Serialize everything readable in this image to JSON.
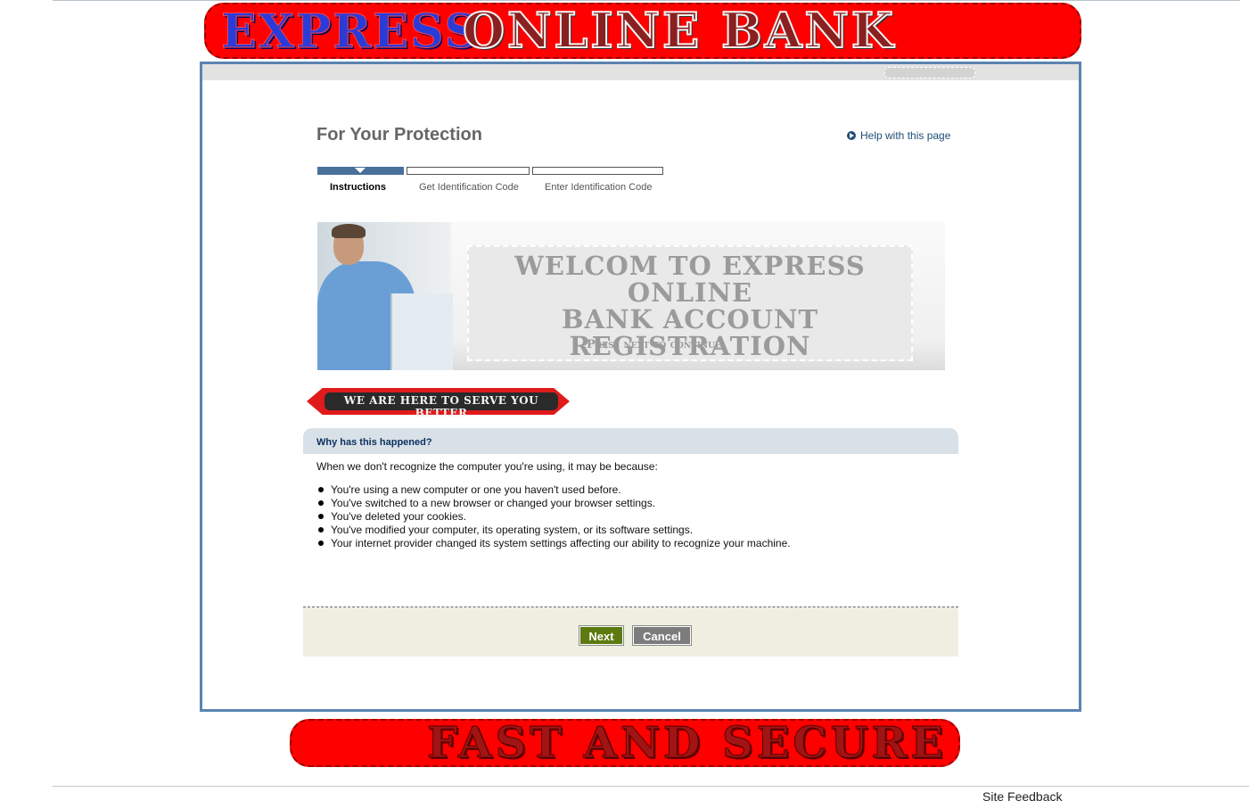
{
  "header": {
    "banner_word1": "EXPRESS",
    "banner_word2": "ONLINE BANK"
  },
  "page": {
    "title": "For Your Protection",
    "help_link": "Help with this page"
  },
  "steps": [
    {
      "label": "Instructions",
      "active": true
    },
    {
      "label": "Get Identification Code",
      "active": false
    },
    {
      "label": "Enter Identification Code",
      "active": false
    }
  ],
  "hero": {
    "line1": "WELCOM TO EXPRESS ONLINE",
    "line2": "BANK ACCOUNT",
    "line3": "REGISTRATION",
    "sub": "Press next to continue"
  },
  "serve_banner": "WE ARE HERE TO SERVE YOU BETTER",
  "why": {
    "title": "Why has this happened?",
    "intro": "When we don't recognize the computer you're using, it may be because:",
    "reasons": [
      "You're using a new computer or one you haven't used before.",
      "You've switched to a new browser or changed your browser settings.",
      "You've deleted your cookies.",
      "You've modified your computer, its operating system, or its software settings.",
      "Your internet provider changed its system settings affecting our ability to recognize your machine."
    ]
  },
  "buttons": {
    "next": "Next",
    "cancel": "Cancel"
  },
  "footer": {
    "banner": "FAST AND SECURE",
    "feedback": "Site Feedback"
  },
  "colors": {
    "banner_red": "#ff0000",
    "frame_blue": "#5b84b1",
    "next_green": "#5c7a10",
    "cancel_gray": "#7c7c7c",
    "header_link": "#1f4e79"
  }
}
